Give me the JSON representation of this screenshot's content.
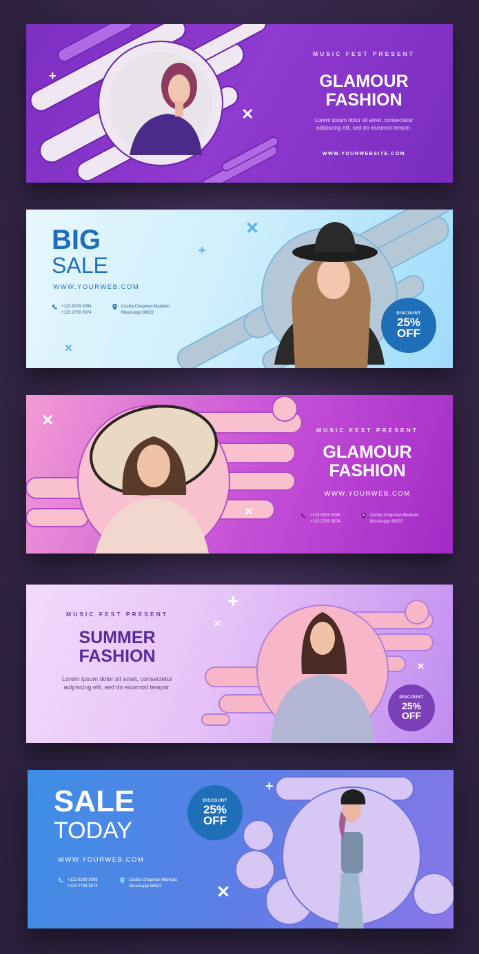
{
  "banner1": {
    "kicker": "MUSIC FEST PRESENT",
    "title_line1": "GLAMOUR",
    "title_line2": "FASHION",
    "body_line1": "Lorem ipsum dolor sit amet, consectetur",
    "body_line2": "adipiscing elit, sed do eiusmod tempor.",
    "website": "WWW.YOURWEBSITE.COM"
  },
  "banner2": {
    "title_line1": "BIG",
    "title_line2": "SALE",
    "website": "WWW.YOURWEB.COM",
    "phone1": "+123 8209 3098",
    "phone2": "+123 2739 3974",
    "address1": "Cecilia Chapman Mankato",
    "address2": "Mississippi 96522",
    "badge_label": "DISCOUNT",
    "badge_value1": "25%",
    "badge_value2": "OFF"
  },
  "banner3": {
    "kicker": "MUSIC FEST PRESENT",
    "title_line1": "GLAMOUR",
    "title_line2": "FASHION",
    "website": "WWW.YOURWEB.COM",
    "phone1": "+123 8209 3098",
    "phone2": "+123 2739 3974",
    "address1": "Cecilia Chapman Mankato",
    "address2": "Mississippi 96522"
  },
  "banner4": {
    "kicker": "MUSIC FEST PRESENT",
    "title_line1": "SUMMER",
    "title_line2": "FASHION",
    "body_line1": "Lorem ipsum dolor sit amet, consectetur",
    "body_line2": "adipiscing elit, sed do eiusmod tempor.",
    "badge_label": "DISCOUNT",
    "badge_value1": "25%",
    "badge_value2": "OFF"
  },
  "banner5": {
    "title_line1": "SALE",
    "title_line2": "TODAY",
    "website": "WWW.YOURWEB.COM",
    "phone1": "+123 8209 3098",
    "phone2": "+123 2739 3974",
    "address1": "Cecilia Chapman Mankato",
    "address2": "Mississippi 96522",
    "badge_label": "DISCOUNT",
    "badge_value1": "25%",
    "badge_value2": "OFF"
  },
  "icons": {
    "phone": "phone-icon",
    "location": "location-pin-icon",
    "plus": "plus-icon",
    "cross": "cross-icon"
  },
  "colors": {
    "page_bg": "#3b2a52",
    "purple": "#7d2fc2",
    "sky_blue": "#1f6fb8",
    "magenta": "#a12ac6",
    "lavender": "#5a2a9a",
    "blue": "#3d8fe6"
  }
}
